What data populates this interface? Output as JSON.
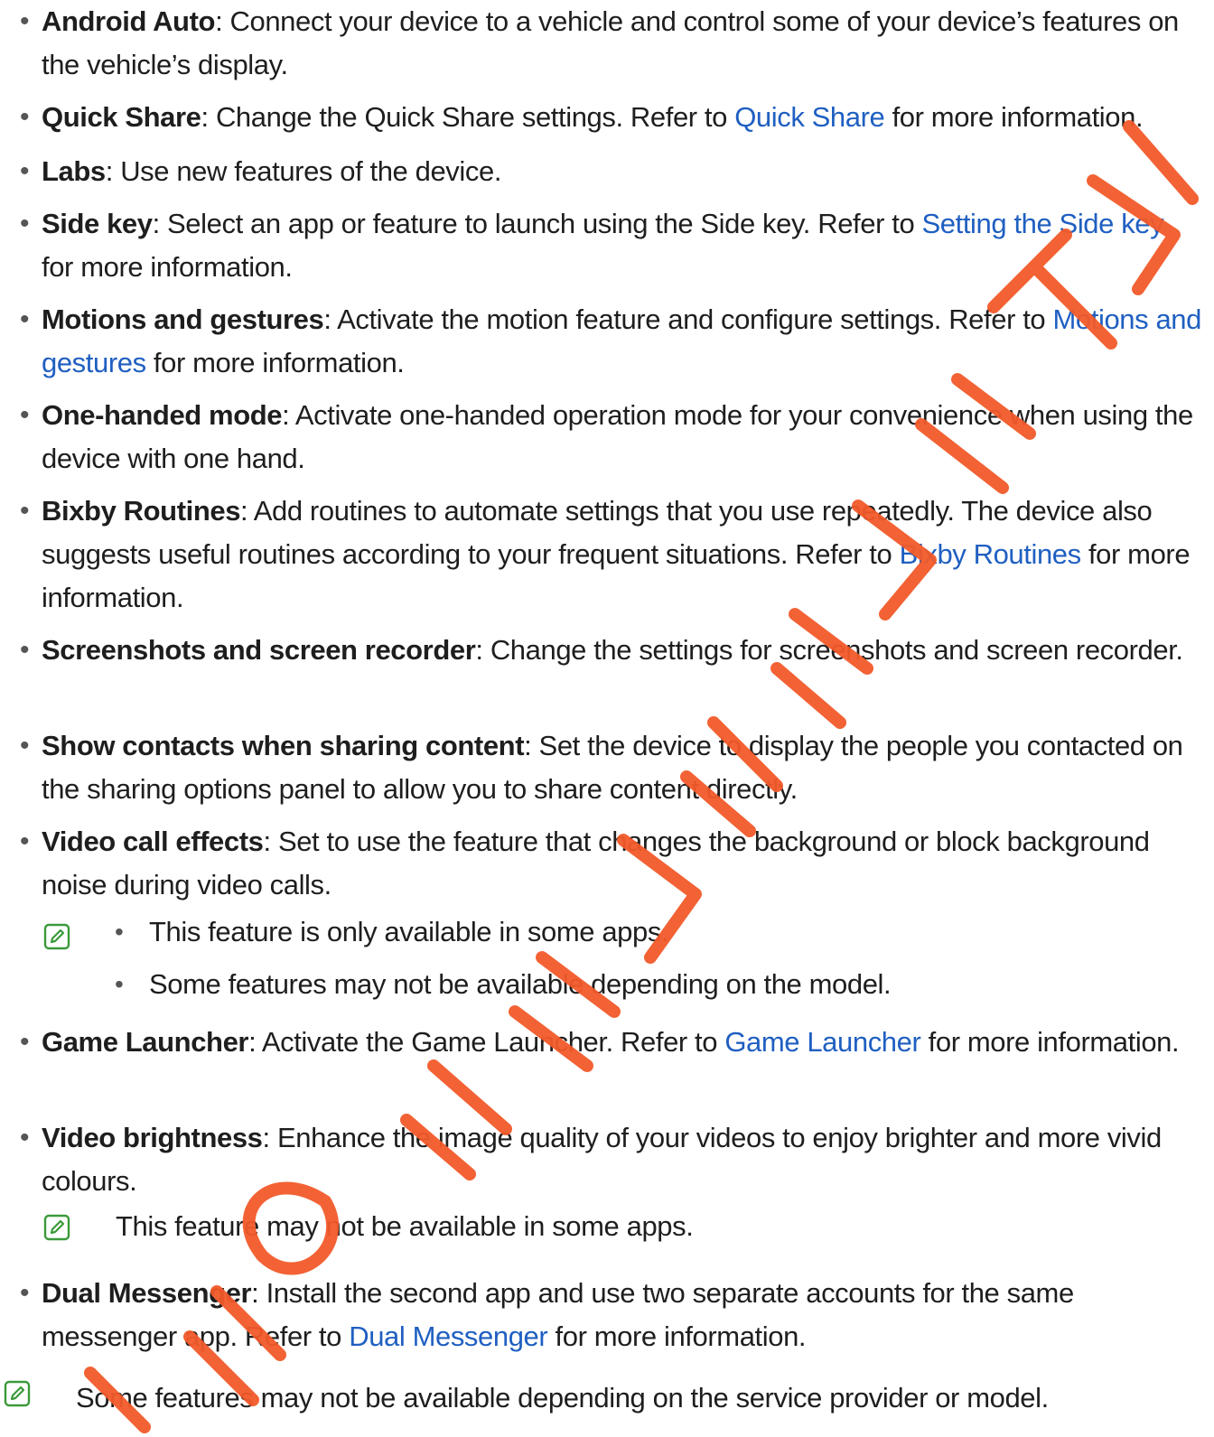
{
  "colors": {
    "link": "#1f5fc1",
    "text": "#1e1e1e",
    "note_icon": "#3a9a3a",
    "watermark": "#f25a2a"
  },
  "items": [
    {
      "term": "Android Auto",
      "desc": ": Connect your device to a vehicle and control some of your device’s features on the vehicle’s display."
    },
    {
      "term": "Quick Share",
      "desc": ": Change the Quick Share settings. Refer to ",
      "link": "Quick Share",
      "after": " for more information."
    },
    {
      "term": "Labs",
      "desc": ": Use new features of the device."
    },
    {
      "term": "Side key",
      "desc": ": Select an app or feature to launch using the Side key. Refer to ",
      "link": "Setting the Side key",
      "after": " for more information."
    },
    {
      "term": "Motions and gestures",
      "desc": ": Activate the motion feature and configure settings. Refer to ",
      "link": "Motions and gestures",
      "after": " for more information."
    },
    {
      "term": "One-handed mode",
      "desc": ": Activate one-handed operation mode for your convenience when using the device with one hand."
    },
    {
      "term": "Bixby Routines",
      "desc": ": Add routines to automate settings that you use repeatedly. The device also suggests useful routines according to your frequent situations. Refer to ",
      "link": "Bixby Routines",
      "after": " for more information."
    },
    {
      "term": "Screenshots and screen recorder",
      "desc": ": Change the settings for screenshots and screen recorder."
    },
    {
      "term": "Show contacts when sharing content",
      "desc": ": Set the device to display the people you contacted on the sharing options panel to allow you to share content directly."
    },
    {
      "term": "Video call effects",
      "desc": ": Set to use the feature that changes the background or block background noise during video calls."
    },
    {
      "term": "Game Launcher",
      "desc": ": Activate the Game Launcher. Refer to ",
      "link": "Game Launcher",
      "after": " for more information."
    },
    {
      "term": "Video brightness",
      "desc": ": Enhance the image quality of your videos to enjoy brighter and more vivid colours."
    },
    {
      "term": "Dual Messenger",
      "desc": ": Install the second app and use two separate accounts for the same messenger app. Refer to ",
      "link": "Dual Messenger",
      "after": " for more information."
    }
  ],
  "notes": {
    "video_call_effects": [
      "This feature is only available in some apps.",
      "Some features may not be available depending on the model."
    ],
    "video_brightness": "This feature may not be available in some apps.",
    "final": "Some features may not be available depending on the service provider or model."
  },
  "bullet_char": "•",
  "note_icon_name": "note-pencil-icon"
}
